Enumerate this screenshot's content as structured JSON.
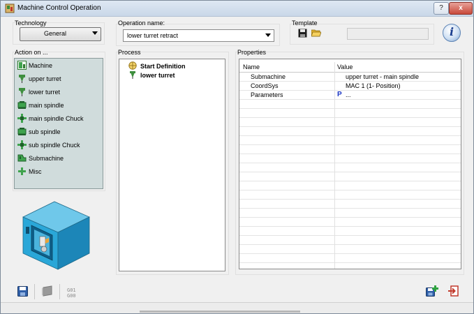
{
  "window": {
    "title": "Machine Control Operation",
    "help_label": "?",
    "close_label": "x"
  },
  "technology": {
    "label": "Technology",
    "selected": "General"
  },
  "operation_name": {
    "label": "Operation name:",
    "value": "lower turret retract"
  },
  "template": {
    "label": "Template",
    "value": ""
  },
  "info": {
    "label": "i"
  },
  "action_on": {
    "label": "Action on ...",
    "items": [
      {
        "label": "Machine",
        "icon": "machine-icon"
      },
      {
        "label": "upper turret",
        "icon": "turret-icon"
      },
      {
        "label": "lower turret",
        "icon": "turret-icon"
      },
      {
        "label": "main spindle",
        "icon": "spindle-icon"
      },
      {
        "label": "main spindle Chuck",
        "icon": "chuck-icon"
      },
      {
        "label": "sub spindle",
        "icon": "spindle-icon"
      },
      {
        "label": "sub spindle Chuck",
        "icon": "chuck-icon"
      },
      {
        "label": "Submachine",
        "icon": "submachine-icon"
      },
      {
        "label": "Misc",
        "icon": "plus-icon"
      }
    ]
  },
  "process": {
    "label": "Process",
    "items": [
      {
        "label": "Start Definition",
        "icon": "start-definition-icon"
      },
      {
        "label": "lower turret",
        "icon": "turret-icon"
      }
    ]
  },
  "properties": {
    "label": "Properties",
    "columns": {
      "name": "Name",
      "value": "Value"
    },
    "rows": [
      {
        "name": "Submachine",
        "value": "upper turret - main spindle",
        "prefix": ""
      },
      {
        "name": "CoordSys",
        "value": "MAC 1 (1- Position)",
        "prefix": ""
      },
      {
        "name": "Parameters",
        "value": "...",
        "prefix": "P"
      }
    ]
  },
  "footer": {
    "gcode_line1": "G01",
    "gcode_line2": "G00"
  },
  "colors": {
    "action_list_bg": "#d0dcdc",
    "param_marker": "#1a36c4",
    "machine_body": "#2aa7d8"
  }
}
